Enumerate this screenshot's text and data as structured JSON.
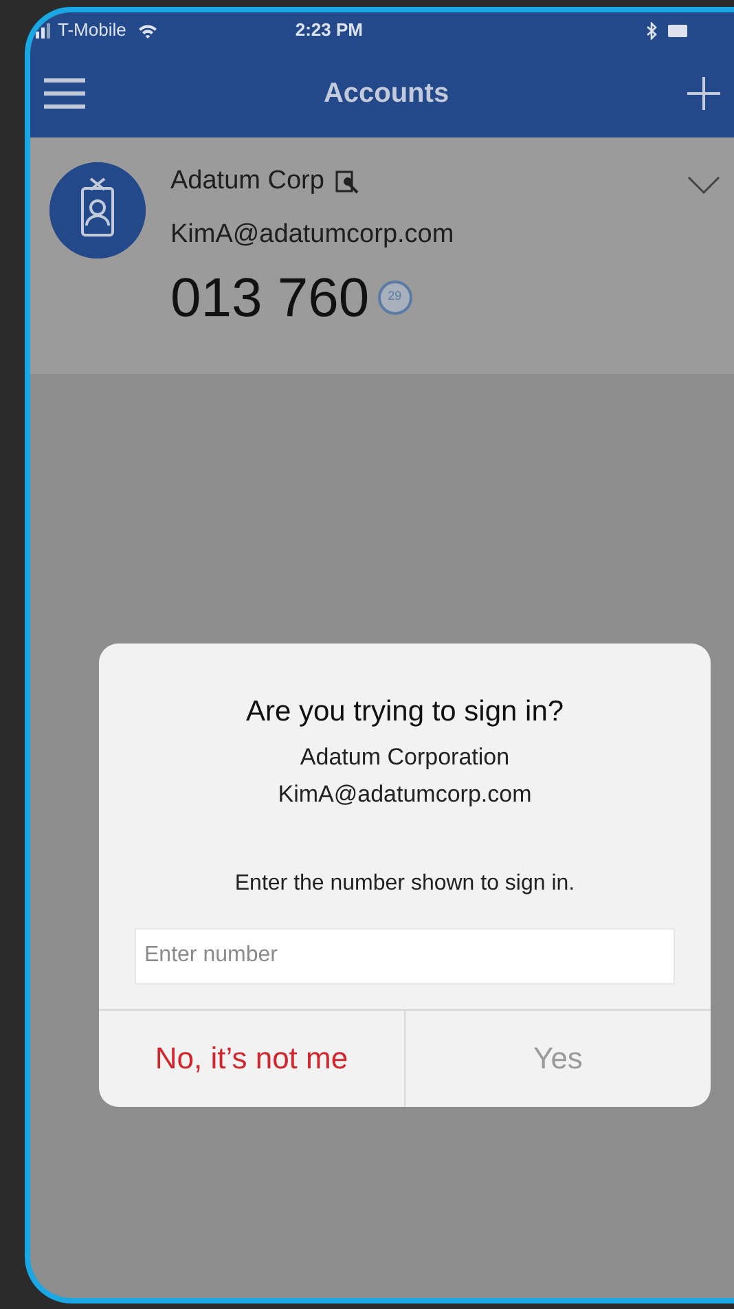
{
  "status_bar": {
    "carrier": "T-Mobile",
    "time": "2:23 PM"
  },
  "header": {
    "title": "Accounts"
  },
  "account": {
    "name": "Adatum Corp",
    "email": "KimA@adatumcorp.com",
    "code": "013 760",
    "countdown": "29",
    "expanded": false
  },
  "dialog": {
    "title": "Are you trying to sign in?",
    "organization": "Adatum Corporation",
    "email": "KimA@adatumcorp.com",
    "prompt": "Enter the number shown to sign in.",
    "input": {
      "placeholder": "Enter number"
    },
    "buttons": [
      {
        "label": "No, it’s not me",
        "kind": "deny",
        "disabled": false
      },
      {
        "label": "Yes",
        "kind": "confirm",
        "disabled": true
      }
    ]
  }
}
